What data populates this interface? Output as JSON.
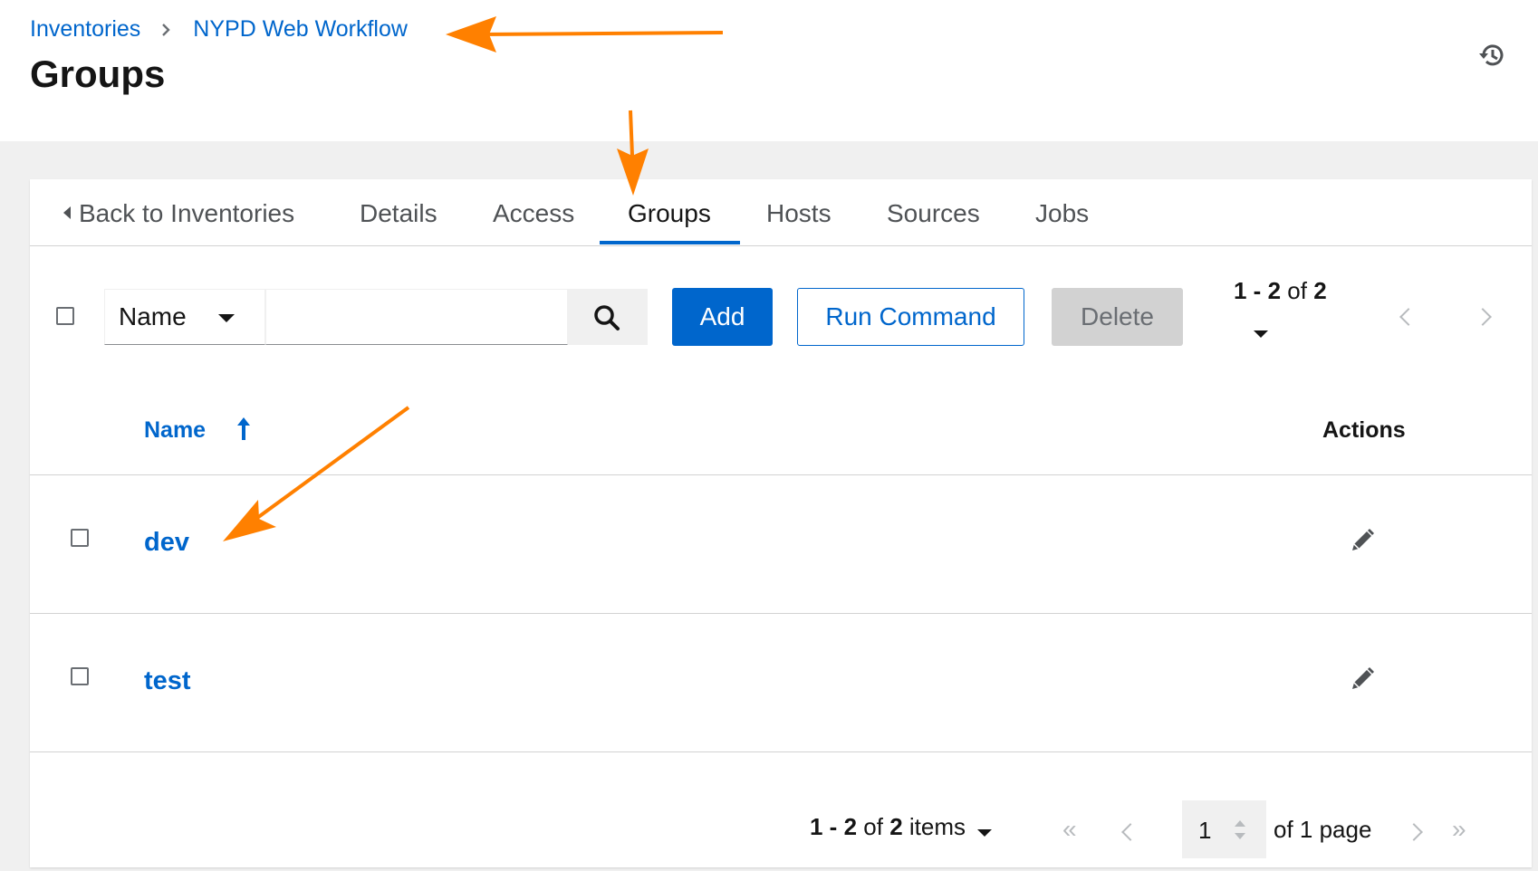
{
  "breadcrumb": {
    "parent": "Inventories",
    "current": "NYPD Web Workflow"
  },
  "page_title": "Groups",
  "tabs": [
    {
      "label": "Back to Inventories"
    },
    {
      "label": "Details"
    },
    {
      "label": "Access"
    },
    {
      "label": "Groups",
      "active": true
    },
    {
      "label": "Hosts"
    },
    {
      "label": "Sources"
    },
    {
      "label": "Jobs"
    }
  ],
  "toolbar": {
    "filter_field": "Name",
    "search_value": "",
    "add_label": "Add",
    "run_command_label": "Run Command",
    "delete_label": "Delete",
    "range": "1 - 2",
    "of_word": "of",
    "total": "2"
  },
  "table": {
    "columns": {
      "name": "Name",
      "actions": "Actions"
    },
    "sort": "ascending",
    "rows": [
      {
        "name": "dev"
      },
      {
        "name": "test"
      }
    ]
  },
  "footer": {
    "range": "1 - 2",
    "of_word": "of",
    "total": "2",
    "items_word": "items",
    "page": "1",
    "of_pages": "of 1 page"
  },
  "colors": {
    "accent": "#0066cc",
    "annotation": "#ff8000",
    "disabled_bg": "#d2d2d2"
  }
}
